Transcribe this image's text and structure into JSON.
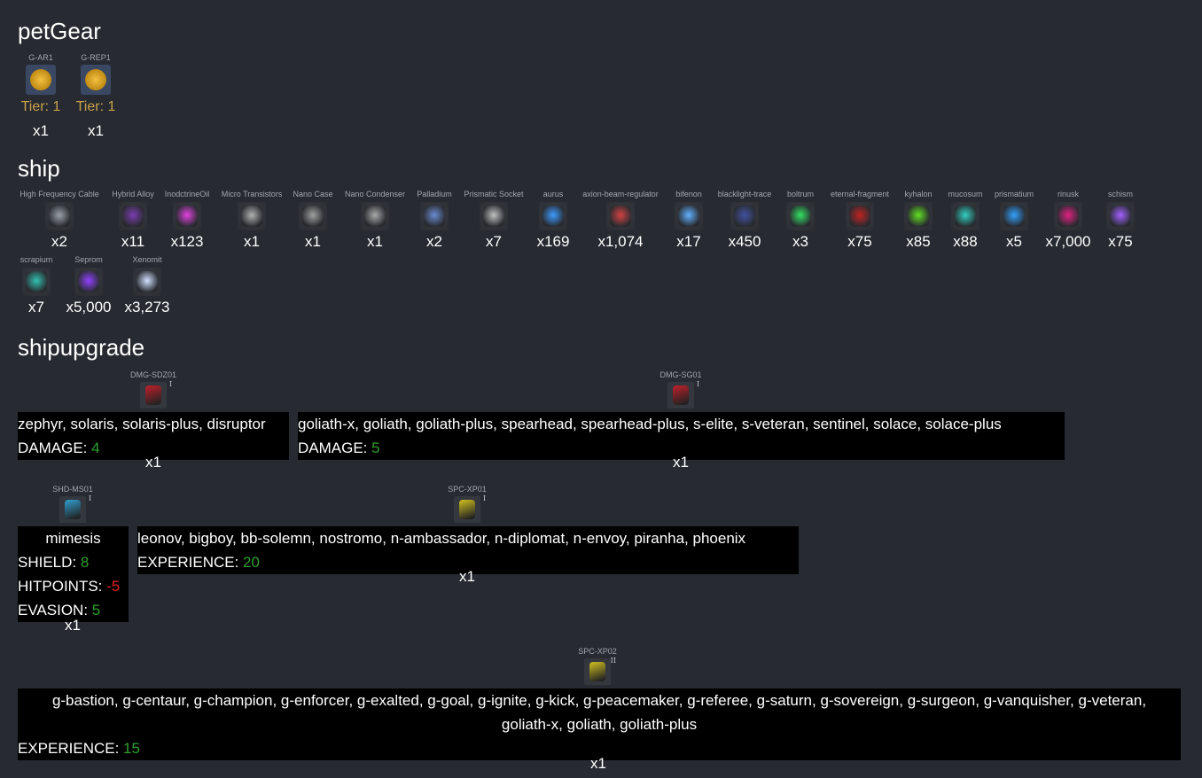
{
  "sections": {
    "pet_gear": "petGear",
    "ship": "ship",
    "ship_upgrade": "shipupgrade"
  },
  "pet_gear": [
    {
      "name": "G-AR1",
      "tier": "Tier: 1",
      "qty": "x1",
      "icon": "shield-gear-icon"
    },
    {
      "name": "G-REP1",
      "tier": "Tier: 1",
      "qty": "x1",
      "icon": "wrench-gear-icon"
    }
  ],
  "ship_items": [
    {
      "name": "High Frequency Cable",
      "qty": "x2",
      "icon": "cable-icon",
      "color": "#9aa0a8"
    },
    {
      "name": "Hybrid Alloy",
      "qty": "x11",
      "icon": "crystal-icon",
      "color": "#7a3ab0"
    },
    {
      "name": "InodctrineOil",
      "qty": "x123",
      "icon": "vial-icon",
      "color": "#e040e0"
    },
    {
      "name": "Micro Transistors",
      "qty": "x1",
      "icon": "chip-icon",
      "color": "#b0b0b0"
    },
    {
      "name": "Nano Case",
      "qty": "x1",
      "icon": "case-icon",
      "color": "#a0a0a0"
    },
    {
      "name": "Nano Condenser",
      "qty": "x1",
      "icon": "condenser-icon",
      "color": "#a8a8a8"
    },
    {
      "name": "Palladium",
      "qty": "x2",
      "icon": "palladium-icon",
      "color": "#6a8ad0"
    },
    {
      "name": "Prismatic Socket",
      "qty": "x7",
      "icon": "socket-icon",
      "color": "#c0c0c0"
    },
    {
      "name": "aurus",
      "qty": "x169",
      "icon": "aurus-icon",
      "color": "#3a9aff"
    },
    {
      "name": "axion-beam-regulator",
      "qty": "x1,074",
      "icon": "regulator-icon",
      "color": "#d04040"
    },
    {
      "name": "bifenon",
      "qty": "x17",
      "icon": "bifenon-icon",
      "color": "#60b0ff"
    },
    {
      "name": "blacklight-trace",
      "qty": "x450",
      "icon": "blacklight-icon",
      "color": "#4050a0"
    },
    {
      "name": "boltrum",
      "qty": "x3",
      "icon": "boltrum-icon",
      "color": "#30e060"
    },
    {
      "name": "eternal-fragment",
      "qty": "x75",
      "icon": "fragment-icon",
      "color": "#c02020"
    },
    {
      "name": "kyhalon",
      "qty": "x85",
      "icon": "kyhalon-icon",
      "color": "#60e020"
    },
    {
      "name": "mucosum",
      "qty": "x88",
      "icon": "mucosum-icon",
      "color": "#30d0c0"
    },
    {
      "name": "prismatium",
      "qty": "x5",
      "icon": "prismatium-icon",
      "color": "#30a0ff"
    },
    {
      "name": "rinusk",
      "qty": "x7,000",
      "icon": "rinusk-icon",
      "color": "#e02080"
    },
    {
      "name": "schism",
      "qty": "x75",
      "icon": "schism-icon",
      "color": "#a060ff"
    },
    {
      "name": "scrapium",
      "qty": "x7",
      "icon": "scrapium-icon",
      "color": "#30c0b0"
    },
    {
      "name": "Seprom",
      "qty": "x5,000",
      "icon": "seprom-icon",
      "color": "#9040ff"
    },
    {
      "name": "Xenomit",
      "qty": "x3,273",
      "icon": "xenomit-icon",
      "color": "#d0e0ff"
    }
  ],
  "upgrades": [
    {
      "name": "DMG-SDZ01",
      "roman": "I",
      "icon": "laser-icon",
      "color": "#c0202a",
      "ships": "zephyr, solaris, solaris-plus, disruptor",
      "stats": [
        {
          "label": "DAMAGE: ",
          "value": "4",
          "kind": "green"
        }
      ],
      "qty": "x1"
    },
    {
      "name": "DMG-SG01",
      "roman": "I",
      "icon": "laser-icon",
      "color": "#c0202a",
      "ships": "goliath-x, goliath, goliath-plus, spearhead, spearhead-plus, s-elite, s-veteran, sentinel, solace, solace-plus",
      "stats": [
        {
          "label": "DAMAGE: ",
          "value": "5",
          "kind": "green"
        }
      ],
      "qty": "x1"
    },
    {
      "name": "SHD-MS01",
      "roman": "I",
      "icon": "shield-module-icon",
      "color": "#30a0d0",
      "ships": "mimesis",
      "stats": [
        {
          "label": "SHIELD: ",
          "value": "8",
          "kind": "green"
        },
        {
          "label": "HITPOINTS: ",
          "value": "-5",
          "kind": "red"
        },
        {
          "label": "EVASION: ",
          "value": "5",
          "kind": "green"
        }
      ],
      "qty": "x1"
    },
    {
      "name": "SPC-XP01",
      "roman": "I",
      "icon": "experience-module-icon",
      "color": "#d0c020",
      "ships": "leonov, bigboy, bb-solemn, nostromo, n-ambassador, n-diplomat, n-envoy, piranha, phoenix",
      "stats": [
        {
          "label": "EXPERIENCE: ",
          "value": "20",
          "kind": "green"
        }
      ],
      "qty": "x1"
    },
    {
      "name": "SPC-XP02",
      "roman": "II",
      "icon": "experience-module-icon",
      "color": "#d0c020",
      "ships": "g-bastion, g-centaur, g-champion, g-enforcer, g-exalted, g-goal, g-ignite, g-kick, g-peacemaker, g-referee, g-saturn, g-sovereign, g-surgeon, g-vanquisher, g-veteran, goliath-x, goliath, goliath-plus",
      "stats": [
        {
          "label": "EXPERIENCE: ",
          "value": "15",
          "kind": "green"
        }
      ],
      "qty": "x1"
    }
  ]
}
